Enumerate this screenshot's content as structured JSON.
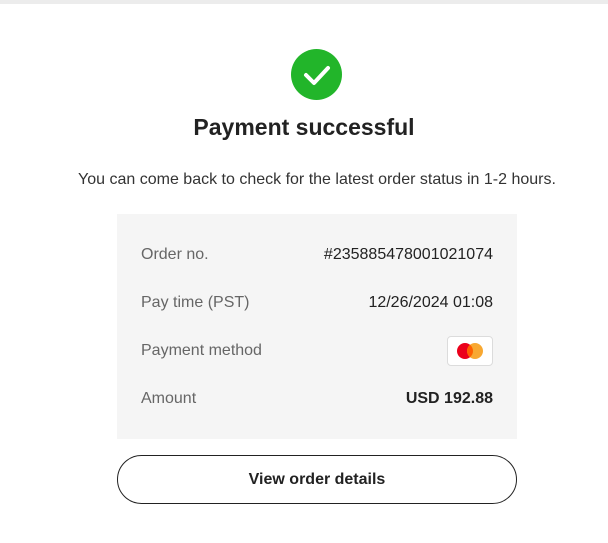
{
  "header": {
    "title": "Payment successful",
    "subtitle": "You can come back to check for the latest order status in 1-2 hours.",
    "icon": "check-circle-icon",
    "icon_color": "#22b52a"
  },
  "details": {
    "order_no": {
      "label": "Order no.",
      "value": "#235885478001021074"
    },
    "pay_time": {
      "label": "Pay time (PST)",
      "value": "12/26/2024 01:08"
    },
    "payment_method": {
      "label": "Payment method",
      "icon": "mastercard-icon"
    },
    "amount": {
      "label": "Amount",
      "value": "USD 192.88"
    }
  },
  "actions": {
    "view_order_label": "View order details"
  }
}
